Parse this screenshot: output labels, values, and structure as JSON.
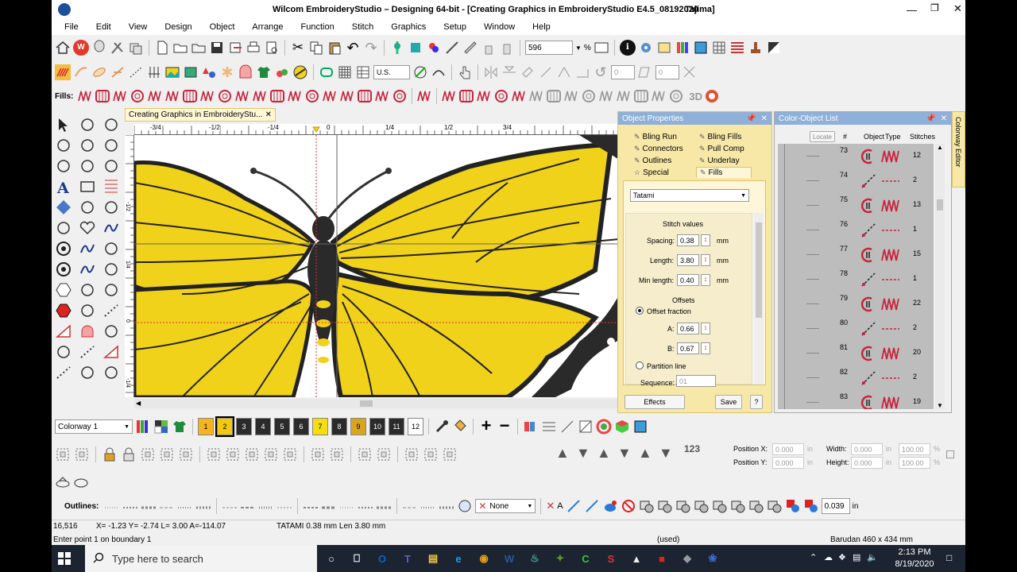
{
  "titlebar": {
    "title": "Wilcom EmbroideryStudio – Designing 64-bit - [Creating Graphics in EmbroideryStudio E4.5_08192020",
    "machine": "Tajima]"
  },
  "menu": [
    "File",
    "Edit",
    "View",
    "Design",
    "Object",
    "Arrange",
    "Function",
    "Stitch",
    "Graphics",
    "Setup",
    "Window",
    "Help"
  ],
  "toolbar": {
    "zoom_value": "596",
    "zoom_unit": "%",
    "units_value": "U.S.",
    "angle_1": "0",
    "angle_2": "0"
  },
  "fills_bar": {
    "label": "Fills:",
    "three_d": "3D"
  },
  "doc_tab": {
    "title": "Creating Graphics in EmbroideryStu..."
  },
  "ruler": {
    "labels": [
      "-3/4",
      "-1/2",
      "-1/4",
      "0",
      "1/4",
      "1/2",
      "3/4"
    ],
    "vlabels": [
      "-1/2",
      "1/4",
      "0",
      "-1/4"
    ]
  },
  "object_properties": {
    "title": "Object Properties",
    "tabs": [
      "Bling Run",
      "Bling Fills",
      "Connectors",
      "Pull Comp",
      "Outlines",
      "Underlay",
      "Special",
      "Fills"
    ],
    "fill_type": "Tatami",
    "stitch_values_label": "Stitch values",
    "spacing": {
      "label": "Spacing:",
      "value": "0.38",
      "unit": "mm"
    },
    "length": {
      "label": "Length:",
      "value": "3.80",
      "unit": "mm"
    },
    "min_length": {
      "label": "Min length:",
      "value": "0.40",
      "unit": "mm"
    },
    "offsets_label": "Offsets",
    "offset_fraction_label": "Offset fraction",
    "a": {
      "label": "A:",
      "value": "0.66"
    },
    "b": {
      "label": "B:",
      "value": "0.67"
    },
    "partition_line_label": "Partition line",
    "sequence": {
      "label": "Sequence:",
      "value": "01"
    },
    "effects_button": "Effects",
    "save_button": "Save",
    "help_button": "?"
  },
  "color_object_list": {
    "title": "Color-Object List",
    "locate": "Locate",
    "headers": [
      "#",
      "Object",
      "Type",
      "Stitches"
    ],
    "rows": [
      {
        "num": "73",
        "kind": "fill",
        "stitches": "12"
      },
      {
        "num": "74",
        "kind": "jump",
        "stitches": "2"
      },
      {
        "num": "75",
        "kind": "fill",
        "stitches": "13"
      },
      {
        "num": "76",
        "kind": "jump",
        "stitches": "1"
      },
      {
        "num": "77",
        "kind": "fill",
        "stitches": "15"
      },
      {
        "num": "78",
        "kind": "jump",
        "stitches": "1"
      },
      {
        "num": "79",
        "kind": "fill",
        "stitches": "22"
      },
      {
        "num": "80",
        "kind": "jump",
        "stitches": "2"
      },
      {
        "num": "81",
        "kind": "fill",
        "stitches": "20"
      },
      {
        "num": "82",
        "kind": "jump",
        "stitches": "2"
      },
      {
        "num": "83",
        "kind": "fill",
        "stitches": "19"
      }
    ],
    "side_tab": "Colorway Editor"
  },
  "colorway": {
    "name": "Colorway 1",
    "swatches": [
      {
        "label": "1",
        "color": "#f5b41f"
      },
      {
        "label": "2",
        "color": "#f2c811"
      },
      {
        "label": "3",
        "color": "#2b2b2b"
      },
      {
        "label": "4",
        "color": "#2b2b2b"
      },
      {
        "label": "5",
        "color": "#2b2b2b"
      },
      {
        "label": "6",
        "color": "#2b2b2b"
      },
      {
        "label": "7",
        "color": "#f5dd10"
      },
      {
        "label": "8",
        "color": "#2b2b2b"
      },
      {
        "label": "9",
        "color": "#d9a520"
      },
      {
        "label": "10",
        "color": "#2b2b2b"
      },
      {
        "label": "11",
        "color": "#2b2b2b"
      },
      {
        "label": "12",
        "color": "#ffffff"
      }
    ]
  },
  "transform": {
    "pos_x_label": "Position X:",
    "pos_x": "0.000",
    "pos_y_label": "Position Y:",
    "pos_y": "0.000",
    "width_label": "Width:",
    "width": "0.000",
    "height_label": "Height:",
    "height": "0.000",
    "unit": "in",
    "pct_w": "100.00",
    "pct_h": "100.00",
    "pct": "%",
    "num_icon": "123"
  },
  "outlines_bar": {
    "label": "Outlines:",
    "none_value": "None",
    "a_label": "A",
    "value": "0.039",
    "unit": "in"
  },
  "status": {
    "count": "16,516",
    "coords": "X=  -1.23 Y=  -2.74 L=  3.00 A=-114.07",
    "stitch": "TATAMI  0.38 mm Len  3.80 mm",
    "prompt": "Enter point 1 on boundary 1",
    "used": "(used)",
    "machine": "Barudan 460 x 434 mm"
  },
  "taskbar": {
    "search_placeholder": "Type here to search",
    "time": "2:13 PM",
    "date": "8/19/2020"
  },
  "colors": {
    "accent": "#8fb0d8",
    "butterfly_yellow": "#f1d21a",
    "panel_bg": "#fdf6d8"
  }
}
